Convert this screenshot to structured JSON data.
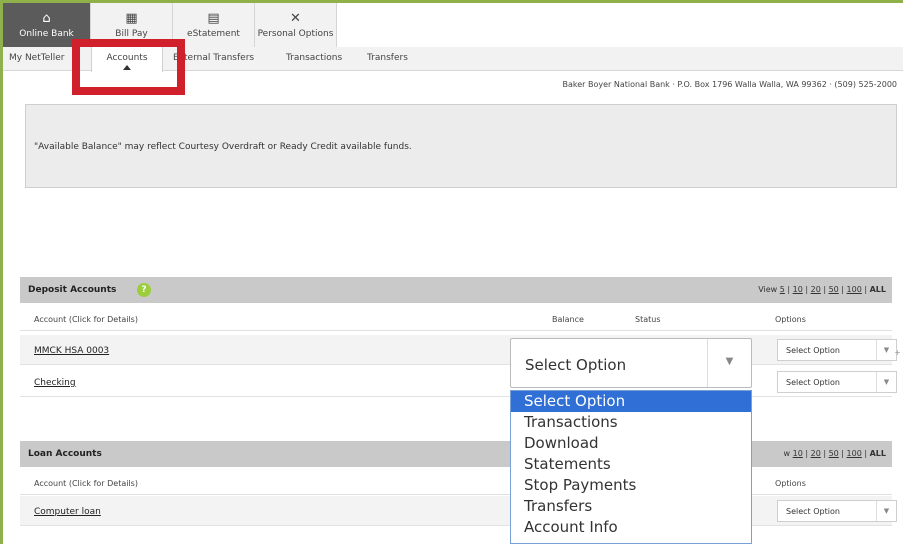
{
  "topnav": [
    {
      "icon": "home-icon",
      "glyph": "⌂",
      "label": "Online Bank",
      "active": true
    },
    {
      "icon": "bill-icon",
      "glyph": "▦",
      "label": "Bill Pay",
      "active": false
    },
    {
      "icon": "document-icon",
      "glyph": "▤",
      "label": "eStatement",
      "active": false
    },
    {
      "icon": "tools-icon",
      "glyph": "✕",
      "label": "Personal Options",
      "active": false
    }
  ],
  "subnav": [
    "My NetTeller",
    "Accounts",
    "External Transfers",
    "Transactions",
    "Transfers"
  ],
  "address": "Baker Boyer National Bank · P.O. Box 1796 Walla Walla, WA 99362 · (509) 525-2000",
  "notice": "\"Available Balance\" may reflect Courtesy Overdraft or Ready Credit available funds.",
  "deposit": {
    "title": "Deposit Accounts",
    "help": "?",
    "view_prefix": "View",
    "view_options": [
      "5",
      "10",
      "20",
      "50",
      "100"
    ],
    "view_all": "ALL",
    "columns": {
      "account": "Account (Click for Details)",
      "balance": "Balance",
      "status": "Status",
      "options": "Options"
    },
    "rows": [
      {
        "account": "MMCK HSA 0003",
        "option": "Select Option"
      },
      {
        "account": "Checking",
        "option": "Select Option"
      }
    ]
  },
  "loan": {
    "title": "Loan Accounts",
    "view_options": [
      "10",
      "20",
      "50",
      "100"
    ],
    "view_all": "ALL",
    "columns": {
      "account": "Account (Click for Details)",
      "options": "Options"
    },
    "rows": [
      {
        "account": "Computer loan",
        "option": "Select Option"
      }
    ]
  },
  "dropdown": {
    "selected": "Select Option",
    "options": [
      "Select Option",
      "Transactions",
      "Download",
      "Statements",
      "Stop Payments",
      "Transfers",
      "Account Info"
    ]
  }
}
